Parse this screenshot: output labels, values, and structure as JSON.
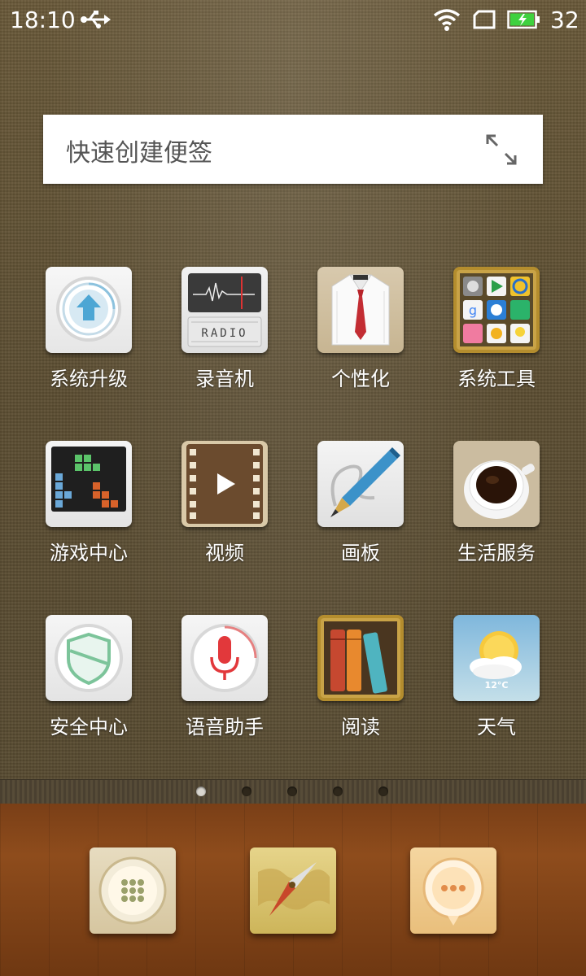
{
  "status_bar": {
    "time": "18:10",
    "battery_level": "32",
    "icons": [
      "usb-icon",
      "wifi-icon",
      "sim-icon",
      "battery-icon"
    ]
  },
  "note_widget": {
    "text": "快速创建便签",
    "icon": "expand-icon"
  },
  "apps": [
    {
      "label": "系统升级",
      "icon": "system-update-icon"
    },
    {
      "label": "录音机",
      "icon": "radio-recorder-icon"
    },
    {
      "label": "个性化",
      "icon": "shirt-tie-icon"
    },
    {
      "label": "系统工具",
      "icon": "tools-folder-icon"
    },
    {
      "label": "游戏中心",
      "icon": "game-center-icon"
    },
    {
      "label": "视频",
      "icon": "video-film-icon"
    },
    {
      "label": "画板",
      "icon": "pen-icon"
    },
    {
      "label": "生活服务",
      "icon": "coffee-cup-icon"
    },
    {
      "label": "安全中心",
      "icon": "shield-icon"
    },
    {
      "label": "语音助手",
      "icon": "microphone-icon"
    },
    {
      "label": "阅读",
      "icon": "books-icon"
    },
    {
      "label": "天气",
      "icon": "weather-icon"
    }
  ],
  "weather": {
    "temperature": "12°C"
  },
  "radio_text": "RADIO",
  "pages": {
    "count": 5,
    "active": 0
  },
  "dock": [
    {
      "name": "phone",
      "icon": "phone-dialpad-icon"
    },
    {
      "name": "browser",
      "icon": "compass-map-icon"
    },
    {
      "name": "messages",
      "icon": "message-bubble-icon"
    }
  ],
  "colors": {
    "wallpaper": "#5d4f33",
    "dock_wood": "#8e4c1c",
    "battery_green": "#3fd13f"
  }
}
